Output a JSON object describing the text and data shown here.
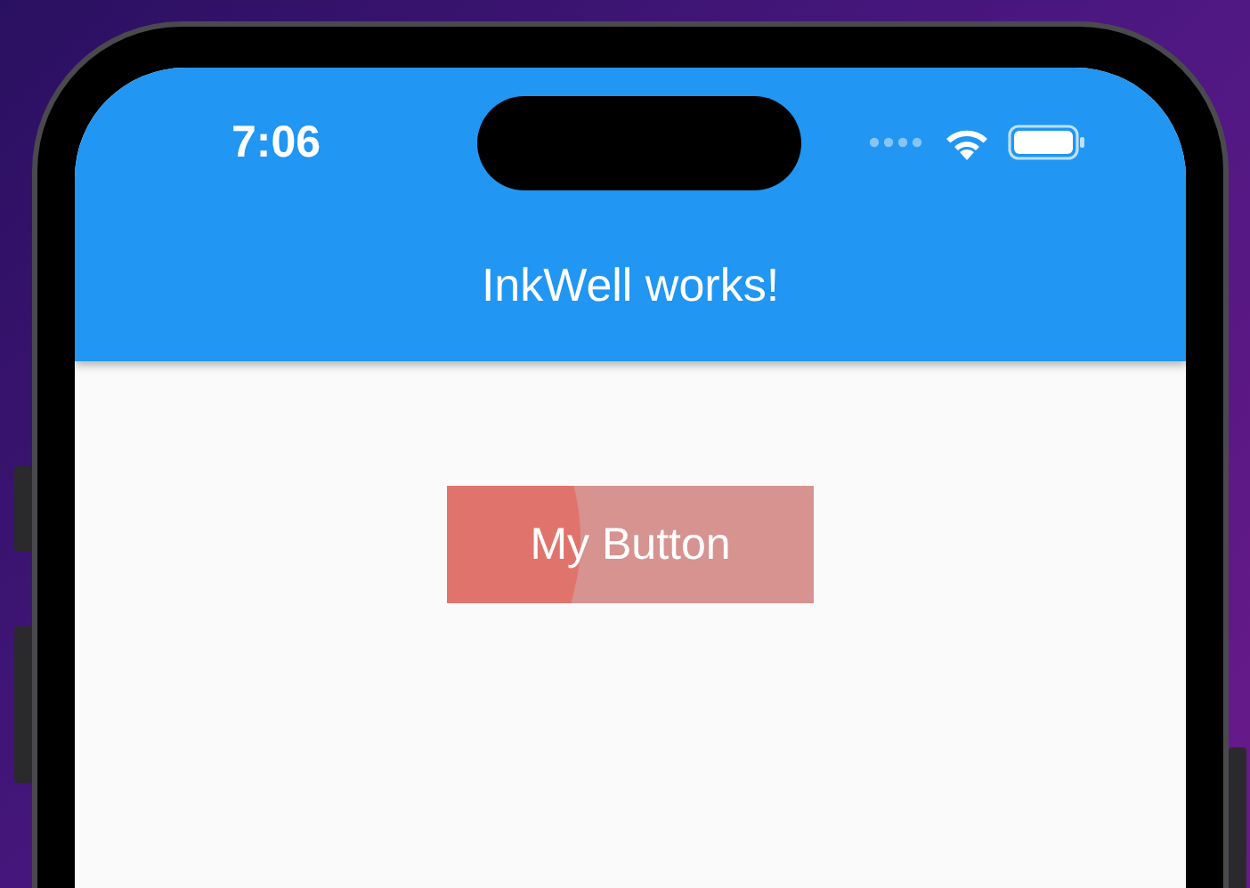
{
  "status_bar": {
    "time": "7:06"
  },
  "app_bar": {
    "title": "InkWell works!"
  },
  "button": {
    "label": "My Button",
    "pressed": true
  }
}
